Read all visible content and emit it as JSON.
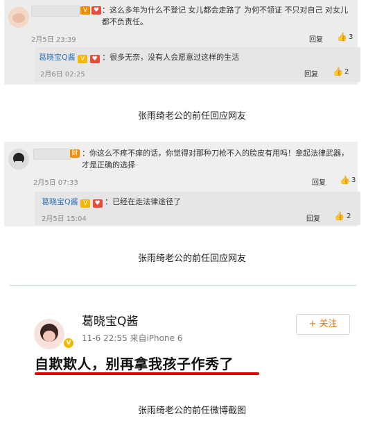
{
  "thread1": {
    "comment_text": "：这么多年为什么不登记 女儿都会走路了 为何不领证 不只对自己 对女儿都不负责任。",
    "date": "2月5日 23:39",
    "reply_label": "回复",
    "like_count": "3",
    "sub": {
      "name": "葛晓宝Q酱",
      "text": "：很多无奈，没有人会愿意过这样的生活",
      "date": "2月6日 02:25",
      "reply_label": "回复",
      "like_count": "2"
    }
  },
  "caption1": "张雨绮老公的前任回应网友",
  "thread2": {
    "comment_text": "：你这么不疼不痒的话，你觉得对那种刀枪不入的脸皮有用吗！拿起法律武器，才是正确的选择",
    "date": "2月5日 07:33",
    "reply_label": "回复",
    "like_count": "3",
    "badge_text": "财",
    "sub": {
      "name": "葛晓宝Q酱",
      "text": "：已经在走法律途径了",
      "date": "2月5日 15:04",
      "reply_label": "回复",
      "like_count": "2"
    }
  },
  "caption2": "张雨绮老公的前任回应网友",
  "weibo": {
    "name": "葛晓宝Q酱",
    "meta": "11-6 22:55 来自iPhone 6",
    "follow_label": "+ 关注",
    "post": "自欺欺人，别再拿我孩子作秀了"
  },
  "caption3": "张雨绮老公的前任微博截图",
  "icons": {
    "vip": "V",
    "heart_badge": "♥",
    "thumb": "👍"
  },
  "colors": {
    "accent_orange": "#e87500",
    "name_blue": "#2f74b6",
    "underline_red": "#e00000"
  }
}
